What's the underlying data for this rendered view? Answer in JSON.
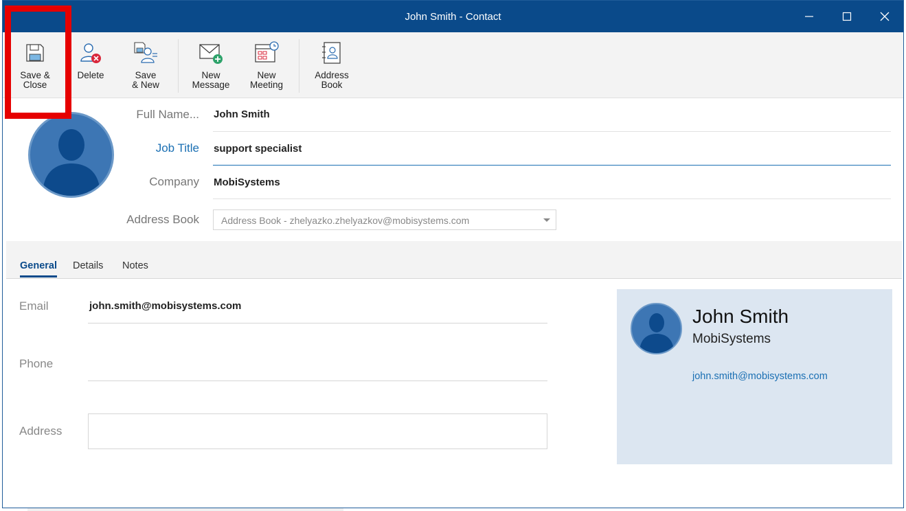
{
  "window": {
    "title": "John Smith - Contact"
  },
  "ribbon": {
    "buttons": [
      {
        "id": "save-close",
        "label": "Save &\nClose",
        "icon": "floppy-disk-icon"
      },
      {
        "id": "delete",
        "label": "Delete",
        "icon": "delete-contact-icon"
      },
      {
        "id": "save-new",
        "label": "Save\n& New",
        "icon": "save-new-contact-icon"
      },
      {
        "id": "new-message",
        "label": "New\nMessage",
        "icon": "new-message-icon"
      },
      {
        "id": "new-meeting",
        "label": "New\nMeeting",
        "icon": "new-meeting-icon"
      },
      {
        "id": "address-book",
        "label": "Address\nBook",
        "icon": "address-book-icon"
      }
    ]
  },
  "form": {
    "full_name_label": "Full Name...",
    "full_name_value": "John Smith",
    "job_title_label": "Job Title",
    "job_title_value": "support specialist",
    "company_label": "Company",
    "company_value": "MobiSystems",
    "address_book_label": "Address Book",
    "address_book_value": "Address Book - zhelyazko.zhelyazkov@mobisystems.com"
  },
  "tabs": [
    {
      "label": "General",
      "active": true
    },
    {
      "label": "Details",
      "active": false
    },
    {
      "label": "Notes",
      "active": false
    }
  ],
  "general": {
    "email_label": "Email",
    "email_value": "john.smith@mobisystems.com",
    "phone_label": "Phone",
    "phone_value": "",
    "address_label": "Address",
    "address_value": ""
  },
  "card": {
    "name": "John Smith",
    "company": "MobiSystems",
    "email": "john.smith@mobisystems.com"
  },
  "colors": {
    "titlebar": "#0a4a8a",
    "accent": "#0a4a8a",
    "highlight": "#e60000",
    "card_bg": "#dce6f1",
    "link": "#1a6fb3"
  }
}
